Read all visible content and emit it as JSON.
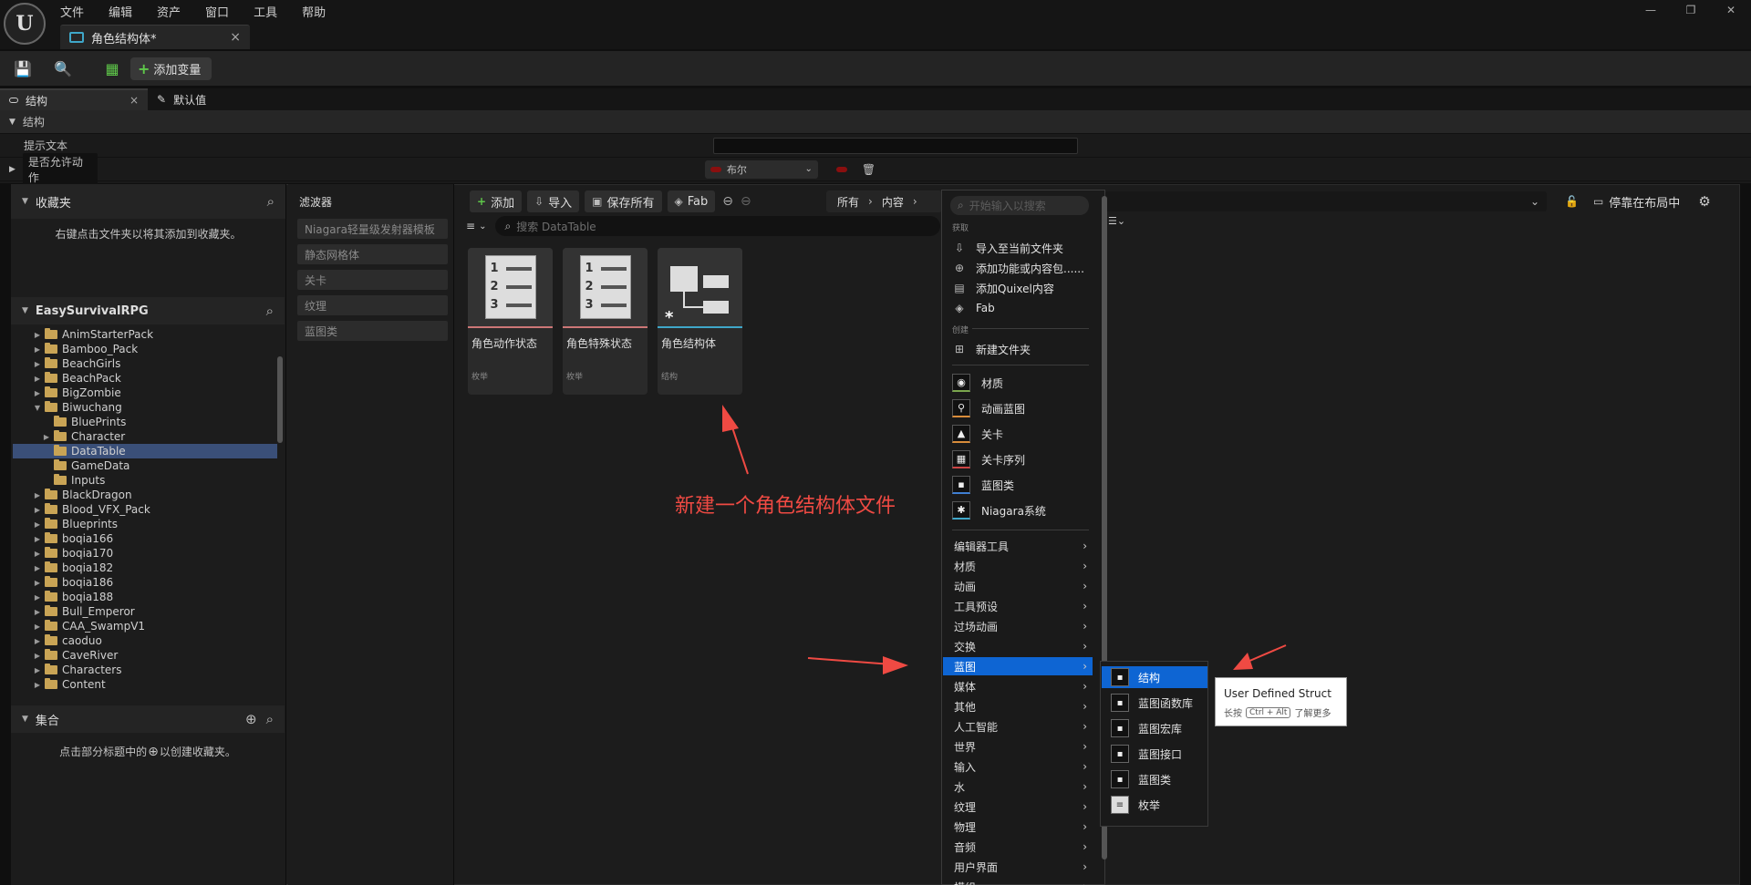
{
  "window": {
    "menu": [
      "文件",
      "编辑",
      "资产",
      "窗口",
      "工具",
      "帮助"
    ],
    "doc_tab": "角色结构体*",
    "close_glyph": "×"
  },
  "toolbar": {
    "add_variable": "添加变量"
  },
  "panel_tabs": [
    {
      "label": "结构"
    },
    {
      "label": "默认值"
    }
  ],
  "struct_panel": {
    "section": "结构",
    "tooltip_label": "提示文本",
    "field_name": "是否允许动作",
    "field_type": "布尔"
  },
  "content_browser": {
    "favorites": {
      "title": "收藏夹",
      "hint": "右键点击文件夹以将其添加到收藏夹。"
    },
    "project": {
      "title": "EasySurvivalRPG"
    },
    "tree": [
      {
        "label": "AnimStarterPack",
        "indent": 1,
        "arrow": "▶"
      },
      {
        "label": "Bamboo_Pack",
        "indent": 1,
        "arrow": "▶"
      },
      {
        "label": "BeachGirls",
        "indent": 1,
        "arrow": "▶"
      },
      {
        "label": "BeachPack",
        "indent": 1,
        "arrow": "▶"
      },
      {
        "label": "BigZombie",
        "indent": 1,
        "arrow": "▶"
      },
      {
        "label": "Biwuchang",
        "indent": 1,
        "arrow": "▼",
        "open": true
      },
      {
        "label": "BluePrints",
        "indent": 2,
        "arrow": ""
      },
      {
        "label": "Character",
        "indent": 2,
        "arrow": "▶"
      },
      {
        "label": "DataTable",
        "indent": 2,
        "arrow": "",
        "selected": true
      },
      {
        "label": "GameData",
        "indent": 2,
        "arrow": ""
      },
      {
        "label": "Inputs",
        "indent": 2,
        "arrow": ""
      },
      {
        "label": "BlackDragon",
        "indent": 1,
        "arrow": "▶"
      },
      {
        "label": "Blood_VFX_Pack",
        "indent": 1,
        "arrow": "▶"
      },
      {
        "label": "Blueprints",
        "indent": 1,
        "arrow": "▶"
      },
      {
        "label": "boqia166",
        "indent": 1,
        "arrow": "▶"
      },
      {
        "label": "boqia170",
        "indent": 1,
        "arrow": "▶"
      },
      {
        "label": "boqia182",
        "indent": 1,
        "arrow": "▶"
      },
      {
        "label": "boqia186",
        "indent": 1,
        "arrow": "▶"
      },
      {
        "label": "boqia188",
        "indent": 1,
        "arrow": "▶"
      },
      {
        "label": "Bull_Emperor",
        "indent": 1,
        "arrow": "▶"
      },
      {
        "label": "CAA_SwampV1",
        "indent": 1,
        "arrow": "▶"
      },
      {
        "label": "caoduo",
        "indent": 1,
        "arrow": "▶"
      },
      {
        "label": "CaveRiver",
        "indent": 1,
        "arrow": "▶"
      },
      {
        "label": "Characters",
        "indent": 1,
        "arrow": "▶"
      },
      {
        "label": "Content",
        "indent": 1,
        "arrow": "▶"
      }
    ],
    "collections": {
      "title": "集合",
      "hint_pre": "点击部分标题中的",
      "hint_post": "以创建收藏夹。"
    },
    "filters": {
      "title": "滤波器",
      "items": [
        "Niagara轻量级发射器模板",
        "静态网格体",
        "关卡",
        "纹理",
        "蓝图类"
      ]
    },
    "buttons": {
      "add": "添加",
      "import": "导入",
      "save_all": "保存所有",
      "fab": "Fab"
    },
    "path": {
      "all": "所有",
      "content": "内容"
    },
    "search_placeholder": "搜索 DataTable",
    "dock_label": "停靠在布局中",
    "assets": [
      {
        "name": "角色动作状态",
        "type": "枚举"
      },
      {
        "name": "角色特殊状态",
        "type": "枚举"
      },
      {
        "name": "角色结构体",
        "type": "结构"
      }
    ]
  },
  "annotation": "新建一个角色结构体文件",
  "context_menu": {
    "search_placeholder": "开始输入以搜索",
    "sec_get": "获取",
    "get_items": [
      "导入至当前文件夹",
      "添加功能或内容包......",
      "添加Quixel内容",
      "Fab"
    ],
    "sec_create": "创建",
    "new_folder": "新建文件夹",
    "basic": [
      "材质",
      "动画蓝图",
      "关卡",
      "关卡序列",
      "蓝图类",
      "Niagara系统"
    ],
    "categories": [
      "编辑器工具",
      "材质",
      "动画",
      "工具预设",
      "过场动画",
      "交换",
      "蓝图",
      "媒体",
      "其他",
      "人工智能",
      "世界",
      "输入",
      "水",
      "纹理",
      "物理",
      "音频",
      "用户界面",
      "模组"
    ],
    "highlight_category": "蓝图"
  },
  "submenu": [
    "结构",
    "蓝图函数库",
    "蓝图宏库",
    "蓝图接口",
    "蓝图类",
    "枚举"
  ],
  "tooltip": {
    "title": "User Defined Struct",
    "hold": "长按",
    "key": "Ctrl + Alt",
    "more": "了解更多"
  },
  "colors": {
    "annotation_red": "#ef4a43",
    "selection_blue": "#0e65d3",
    "add_green": "#5fc84a"
  }
}
